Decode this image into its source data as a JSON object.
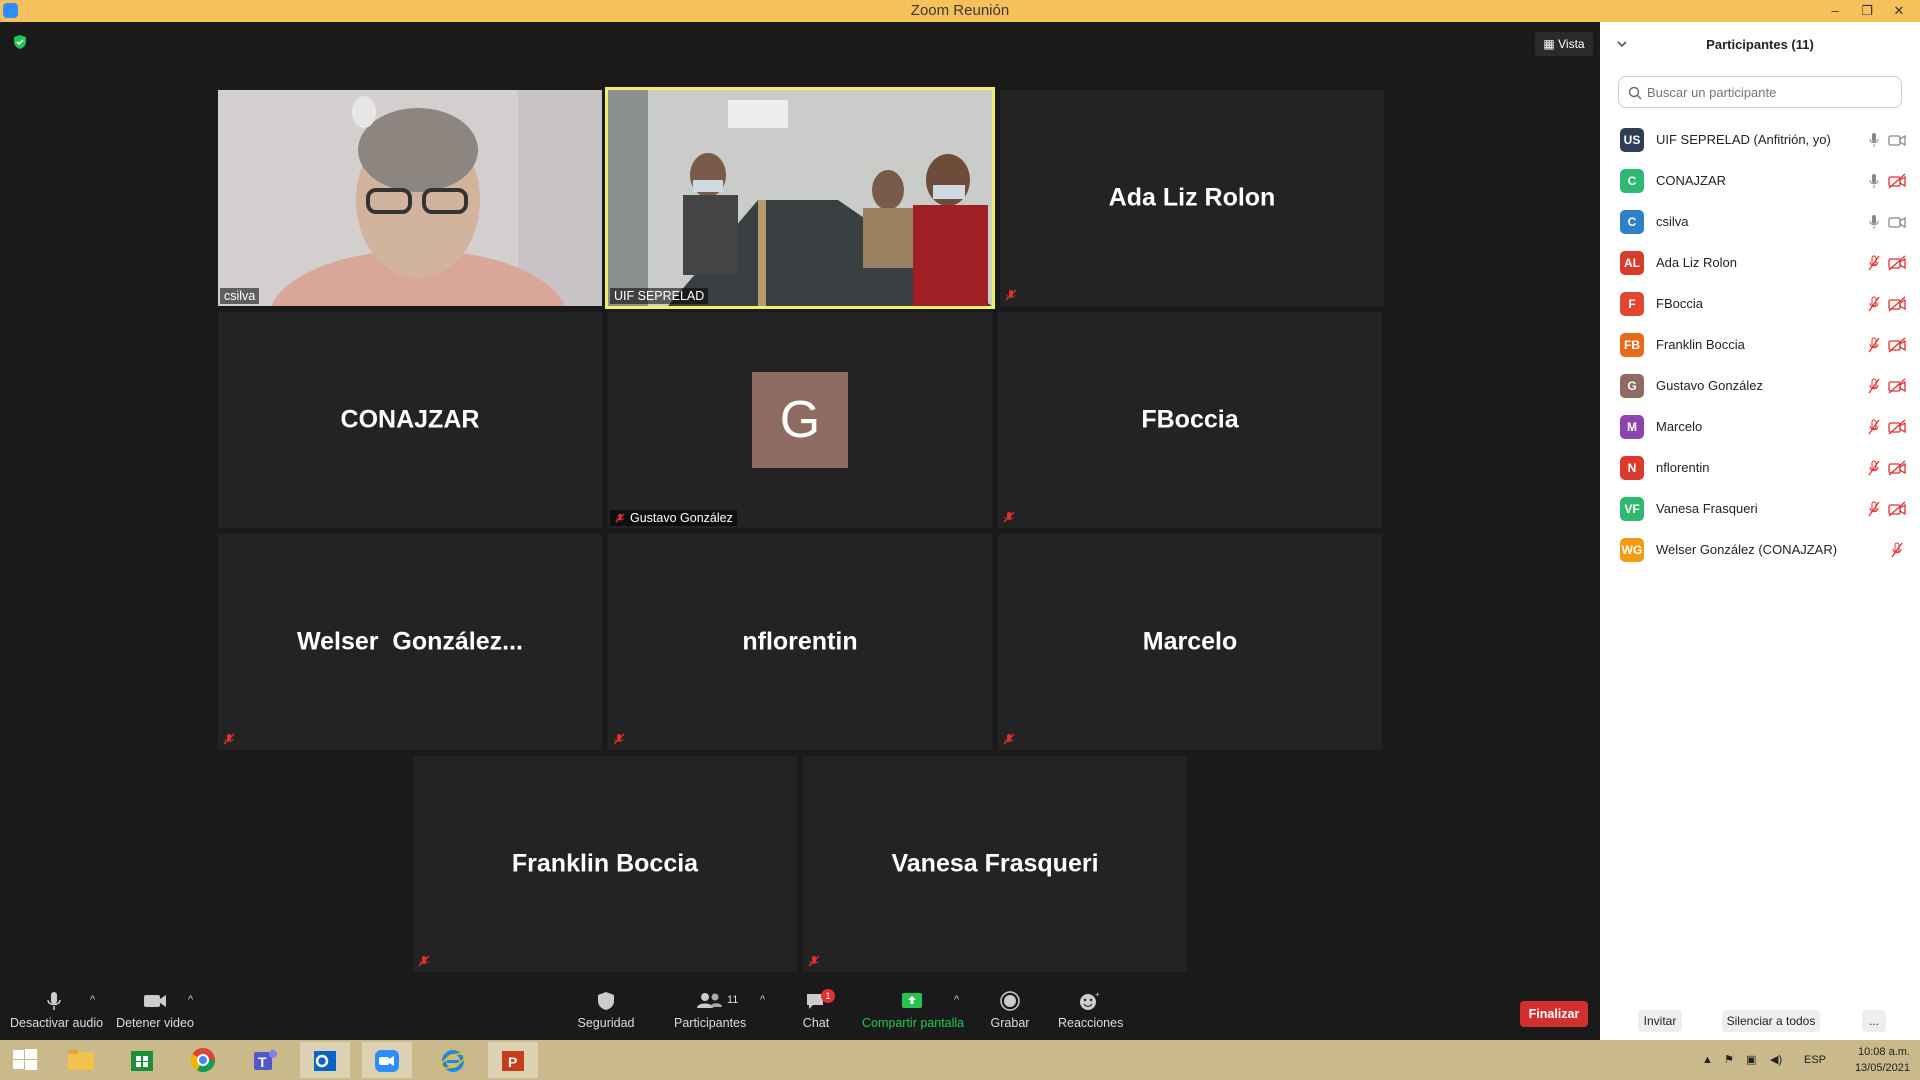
{
  "window": {
    "title": "Zoom Reunión",
    "minimize": "–",
    "restore": "❐",
    "close": "✕"
  },
  "view": {
    "label": "Vista"
  },
  "tiles": {
    "csilva": {
      "name": "csilva"
    },
    "uif": {
      "name": "UIF SEPRELAD"
    },
    "ada": {
      "big": "Ada Liz Rolon"
    },
    "conajzar": {
      "big": "CONAJZAR"
    },
    "gustavo": {
      "initial": "G",
      "name": "Gustavo González"
    },
    "fboccia": {
      "big": "FBoccia"
    },
    "welser": {
      "big": "Welser  González..."
    },
    "nflorentin": {
      "big": "nflorentin"
    },
    "marcelo": {
      "big": "Marcelo"
    },
    "franklin": {
      "big": "Franklin Boccia"
    },
    "vanesa": {
      "big": "Vanesa Frasqueri"
    }
  },
  "toolbar": {
    "audio": "Desactivar audio",
    "video": "Detener video",
    "security": "Seguridad",
    "participants": "Participantes",
    "participants_count": "11",
    "chat": "Chat",
    "chat_badge": "1",
    "share": "Compartir pantalla",
    "record": "Grabar",
    "reactions": "Reacciones",
    "end": "Finalizar",
    "caret": "^"
  },
  "panel": {
    "title": "Participantes (11)",
    "search_placeholder": "Buscar un participante",
    "participants": [
      {
        "initials": "US",
        "name": "UIF SEPRELAD (Anfitrión, yo)",
        "color": "#2f3e57",
        "mic": "on",
        "cam": "on"
      },
      {
        "initials": "C",
        "name": "CONAJZAR",
        "color": "#2eb872",
        "mic": "on",
        "cam": "off"
      },
      {
        "initials": "C",
        "name": "csilva",
        "color": "#2f80c4",
        "mic": "on",
        "cam": "on"
      },
      {
        "initials": "AL",
        "name": "Ada Liz Rolon",
        "color": "#d93a2b",
        "mic": "off",
        "cam": "off"
      },
      {
        "initials": "F",
        "name": "FBoccia",
        "color": "#e0452d",
        "mic": "off",
        "cam": "off"
      },
      {
        "initials": "FB",
        "name": "Franklin Boccia",
        "color": "#e8691c",
        "mic": "off",
        "cam": "off"
      },
      {
        "initials": "G",
        "name": "Gustavo González",
        "color": "#8e6c61",
        "mic": "off",
        "cam": "off"
      },
      {
        "initials": "M",
        "name": "Marcelo",
        "color": "#8e44ad",
        "mic": "off",
        "cam": "off"
      },
      {
        "initials": "N",
        "name": "nflorentin",
        "color": "#d93a2b",
        "mic": "off",
        "cam": "off"
      },
      {
        "initials": "VF",
        "name": "Vanesa Frasqueri",
        "color": "#2eb872",
        "mic": "off",
        "cam": "off"
      },
      {
        "initials": "WG",
        "name": "Welser González (CONAJZAR)",
        "color": "#f39c12",
        "mic": "off",
        "cam": "none"
      }
    ],
    "invite": "Invitar",
    "mute_all": "Silenciar a todos",
    "more": "..."
  },
  "taskbar": {
    "language": "ESP",
    "time": "10:08 a.m.",
    "date": "13/05/2021",
    "tray_caret": "▲"
  },
  "colors": {
    "titlebar": "#f6c05a",
    "active_speaker": "#eef06a",
    "end_button": "#d32f2f",
    "share_green": "#23c552",
    "muted_red": "#e03131"
  }
}
